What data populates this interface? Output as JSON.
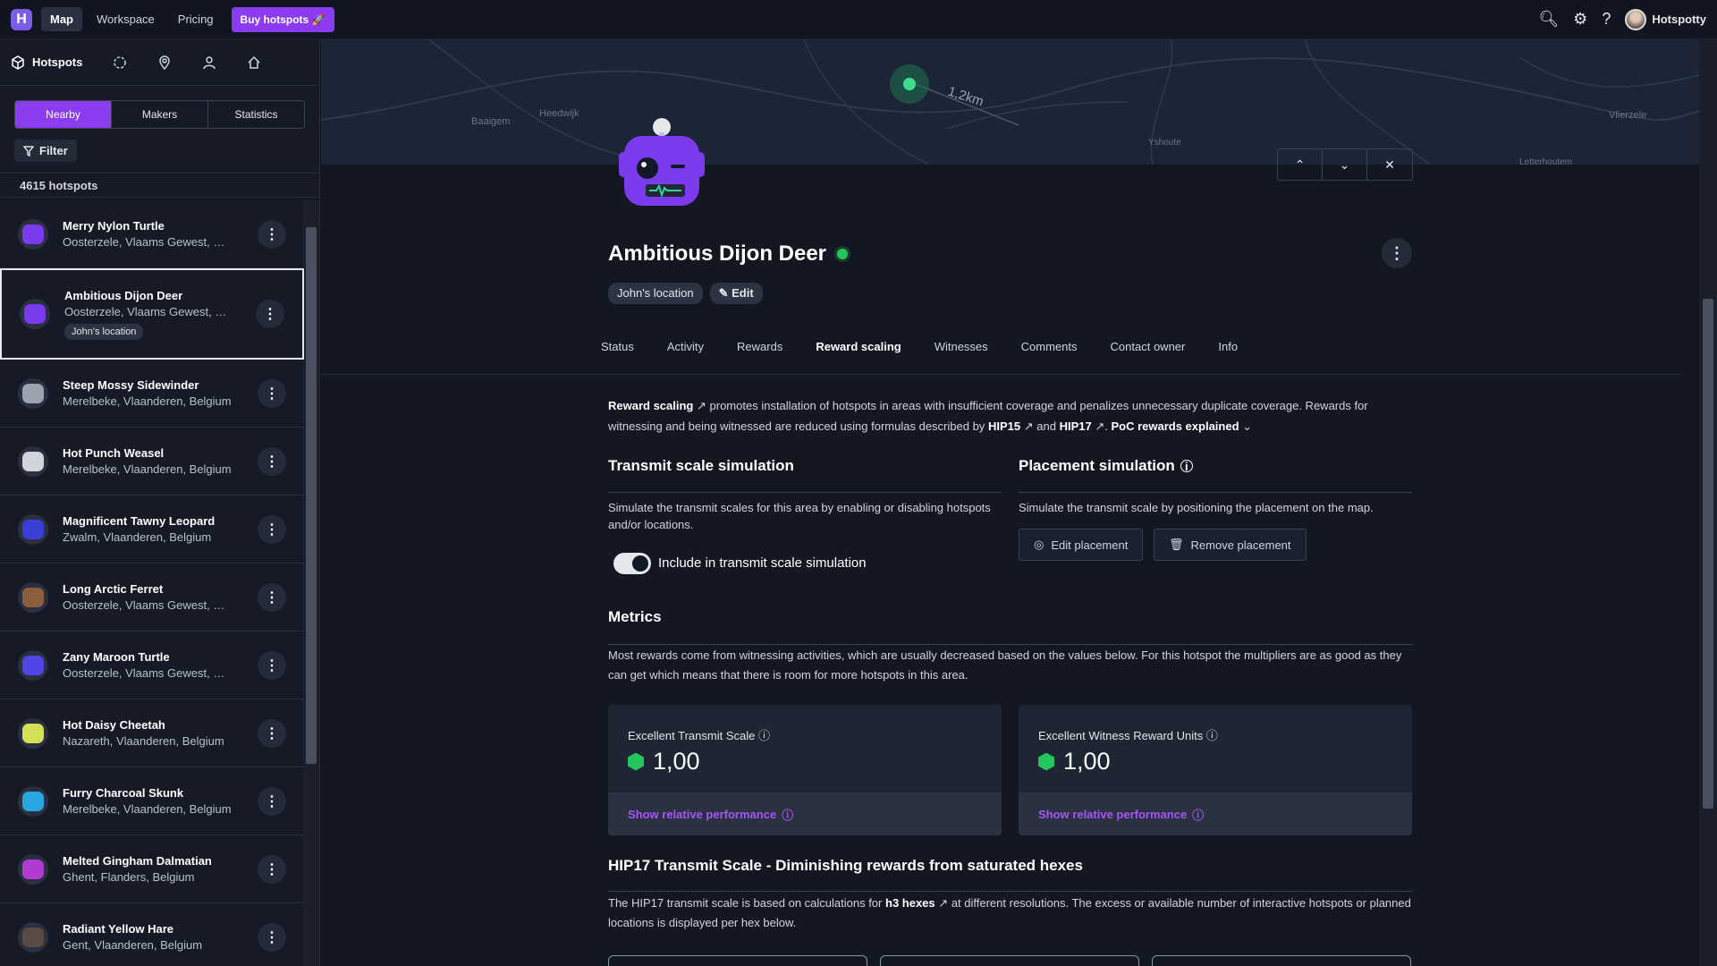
{
  "topnav": {
    "logo": "H",
    "items": [
      "Map",
      "Workspace",
      "Pricing"
    ],
    "buy_label": "Buy hotspots",
    "user": "Hotspotty"
  },
  "sidebar": {
    "tabs": [
      {
        "label": "Hotspots",
        "icon": "cube-icon"
      },
      {
        "icon": "select-region-icon"
      },
      {
        "icon": "location-pin-icon"
      },
      {
        "icon": "user-icon"
      },
      {
        "icon": "home-icon"
      }
    ],
    "segments": [
      "Nearby",
      "Makers",
      "Statistics"
    ],
    "filter_label": "Filter",
    "count": "4615 hotspots",
    "hotspots": [
      {
        "name": "Merry Nylon Turtle",
        "location": "Oosterzele, Vlaams Gewest, Be...",
        "color": "#7c3aed"
      },
      {
        "name": "Ambitious Dijon Deer",
        "location": "Oosterzele, Vlaams Gewest, Be...",
        "tag": "John's location",
        "color": "#7c3aed"
      },
      {
        "name": "Steep Mossy Sidewinder",
        "location": "Merelbeke, Vlaanderen, Belgium",
        "color": "#9ca3af"
      },
      {
        "name": "Hot Punch Weasel",
        "location": "Merelbeke, Vlaanderen, Belgium",
        "color": "#d1d5db"
      },
      {
        "name": "Magnificent Tawny Leopard",
        "location": "Zwalm, Vlaanderen, Belgium",
        "color": "#3b3fd8"
      },
      {
        "name": "Long Arctic Ferret",
        "location": "Oosterzele, Vlaams Gewest, Be...",
        "color": "#8b5e3c"
      },
      {
        "name": "Zany Maroon Turtle",
        "location": "Oosterzele, Vlaams Gewest, Be...",
        "color": "#4f46e5"
      },
      {
        "name": "Hot Daisy Cheetah",
        "location": "Nazareth, Vlaanderen, Belgium",
        "color": "#d4e157"
      },
      {
        "name": "Furry Charcoal Skunk",
        "location": "Merelbeke, Vlaanderen, Belgium",
        "color": "#29a7e1"
      },
      {
        "name": "Melted Gingham Dalmatian",
        "location": "Ghent, Flanders, Belgium",
        "color": "#b03bd0"
      },
      {
        "name": "Radiant Yellow Hare",
        "location": "Gent, Vlaanderen, Belgium",
        "color": "#5b4a44"
      }
    ]
  },
  "map": {
    "distance": "1,2km",
    "labels": [
      "Baaigem",
      "Heedwijk",
      "Yshoute",
      "Vlierzele",
      "Letterhoutem"
    ]
  },
  "detail": {
    "title": "Ambitious Dijon Deer",
    "chip_location": "John's location",
    "chip_edit": "Edit",
    "tabs": [
      "Status",
      "Activity",
      "Rewards",
      "Reward scaling",
      "Witnesses",
      "Comments",
      "Contact owner",
      "Info"
    ],
    "intro_link": "Reward scaling",
    "intro_1": " promotes installation of hotspots in areas with insufficient coverage and penalizes unnecessary duplicate coverage. Rewards for",
    "intro_2": "witnessing and being witnessed are reduced using formulas described by",
    "hip15": "HIP15",
    "and": "and",
    "hip17": "HIP17",
    "poc": "PoC rewards explained",
    "transmit_title": "Transmit scale simulation",
    "transmit_desc_1": "Simulate the transmit scales for this area by enabling or disabling hotspots",
    "transmit_desc_2": "and/or locations.",
    "toggle_label": "Include in transmit scale simulation",
    "placement_title": "Placement simulation",
    "placement_desc": "Simulate the transmit scale by positioning the placement on the map.",
    "edit_placement": "Edit placement",
    "remove_placement": "Remove placement",
    "metrics_title": "Metrics",
    "metrics_desc_1": "Most rewards come from witnessing activities, which are usually decreased based on the values below. For this hotspot the multipliers are as good as they",
    "metrics_desc_2": "can get which means that there is room for more hotspots in this area.",
    "cards": [
      {
        "title": "Excellent Transmit Scale",
        "value": "1,00",
        "footer": "Show relative performance"
      },
      {
        "title": "Excellent Witness Reward Units",
        "value": "1,00",
        "footer": "Show relative performance"
      }
    ],
    "hip17_title": "HIP17 Transmit Scale - Diminishing rewards from saturated hexes",
    "hip17_desc_a": "The HIP17 transmit scale is based on calculations for",
    "hip17_h3": "h3 hexes",
    "hip17_desc_b": "at different resolutions. The excess or available number of interactive hotspots or planned",
    "hip17_desc_2": "locations is displayed per hex below."
  }
}
